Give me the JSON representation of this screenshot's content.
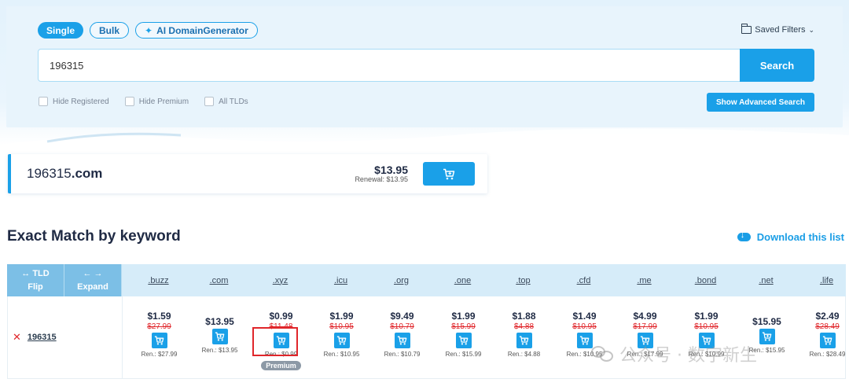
{
  "modes": [
    {
      "label": "Single",
      "active": true
    },
    {
      "label": "Bulk",
      "active": false
    },
    {
      "label": "AI DomainGenerator",
      "active": false,
      "icon": "sparkle-icon"
    }
  ],
  "saved_filters": {
    "label": "Saved Filters",
    "icon": "folder-icon"
  },
  "search": {
    "value": "196315",
    "button": "Search"
  },
  "filters": [
    {
      "label": "Hide Registered",
      "checked": false
    },
    {
      "label": "Hide Premium",
      "checked": false
    },
    {
      "label": "All TLDs",
      "checked": false
    }
  ],
  "advanced_button": "Show Advanced Search",
  "result": {
    "name": "196315",
    "tld": ".com",
    "price": "$13.95",
    "renewal": "Renewal: $13.95"
  },
  "section": {
    "title": "Exact Match by keyword",
    "download": "Download this list"
  },
  "table": {
    "head_tld_top": "↔ TLD",
    "head_tld_bottom": "Flip",
    "head_expand_top": "← →",
    "head_expand_bottom": "Expand",
    "keyword": "196315",
    "remove_icon": "✕",
    "tlds": [
      {
        "tld": ".buzz",
        "price": "$1.59",
        "old": "$27.99",
        "ren": "Ren.: $27.99"
      },
      {
        "tld": ".com",
        "price": "$13.95",
        "old": "",
        "ren": "Ren.: $13.95"
      },
      {
        "tld": ".xyz",
        "price": "$0.99",
        "old": "$11.48",
        "ren": "Ren.: $0.99",
        "badge": "Premium"
      },
      {
        "tld": ".icu",
        "price": "$1.99",
        "old": "$10.95",
        "ren": "Ren.: $10.95"
      },
      {
        "tld": ".org",
        "price": "$9.49",
        "old": "$10.79",
        "ren": "Ren.: $10.79"
      },
      {
        "tld": ".one",
        "price": "$1.99",
        "old": "$15.99",
        "ren": "Ren.: $15.99"
      },
      {
        "tld": ".top",
        "price": "$1.88",
        "old": "$4.88",
        "ren": "Ren.: $4.88"
      },
      {
        "tld": ".cfd",
        "price": "$1.49",
        "old": "$10.95",
        "ren": "Ren.: $10.95"
      },
      {
        "tld": ".me",
        "price": "$4.99",
        "old": "$17.99",
        "ren": "Ren.: $17.99"
      },
      {
        "tld": ".bond",
        "price": "$1.99",
        "old": "$10.95",
        "ren": "Ren.: $10.99"
      },
      {
        "tld": ".net",
        "price": "$15.95",
        "old": "",
        "ren": "Ren.: $15.95"
      },
      {
        "tld": ".life",
        "price": "$2.49",
        "old": "$28.49",
        "ren": "Ren.: $28.49"
      }
    ]
  },
  "watermark": "公众号 · 数字新生",
  "colors": {
    "accent": "#1aa0e8",
    "strike": "#e0262b",
    "header": "#7cbfe6"
  }
}
